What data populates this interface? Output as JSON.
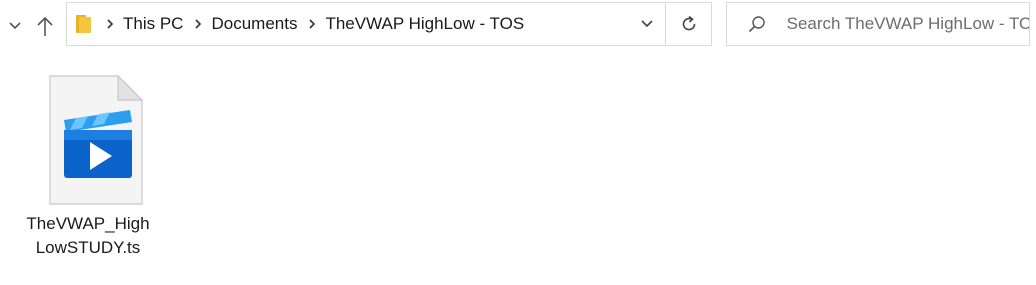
{
  "nav": {
    "recent_icon": "chevron-down-icon",
    "up_icon": "up-arrow-icon"
  },
  "address": {
    "folder_icon": "folder-icon",
    "breadcrumbs": [
      "This PC",
      "Documents",
      "TheVWAP HighLow - TOS"
    ],
    "dropdown_icon": "chevron-down-icon",
    "refresh_icon": "refresh-icon"
  },
  "search": {
    "placeholder": "Search TheVWAP HighLow - TOS",
    "icon": "search-icon"
  },
  "files": [
    {
      "name": "TheVWAP_HighLowSTUDY.ts",
      "icon": "video-file-icon"
    }
  ],
  "colors": {
    "accent_blue": "#0a63c9",
    "folder_yellow": "#f5c542",
    "border": "#d9d9d9"
  }
}
